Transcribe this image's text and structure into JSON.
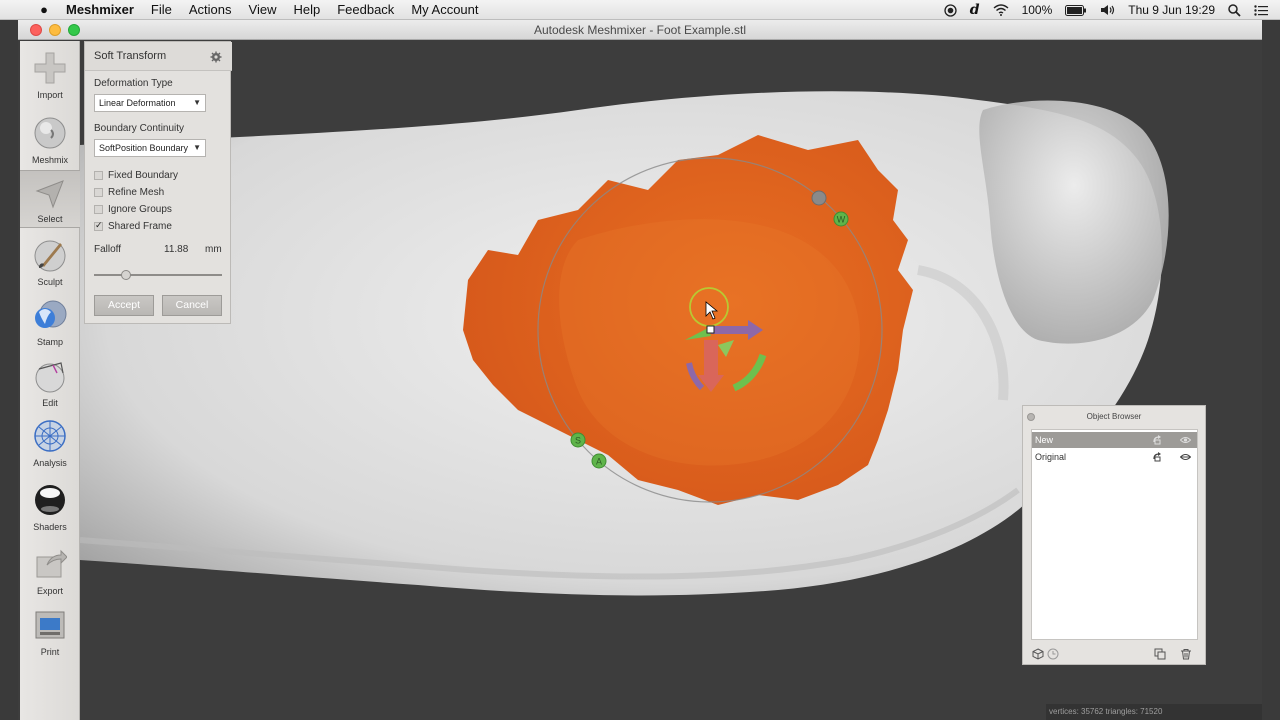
{
  "menubar": {
    "app_name": "Meshmixer",
    "menus": [
      "File",
      "Actions",
      "View",
      "Help",
      "Feedback",
      "My Account"
    ],
    "battery": "100%",
    "clock": "Thu 9 Jun  19:29"
  },
  "window": {
    "title": "Autodesk Meshmixer - Foot Example.stl"
  },
  "toolbar": {
    "items": [
      {
        "label": "Import",
        "icon": "plus-icon"
      },
      {
        "label": "Meshmix",
        "icon": "meshmix-sphere-icon"
      },
      {
        "label": "Select",
        "icon": "select-arrow-icon",
        "active": true
      },
      {
        "label": "Sculpt",
        "icon": "sculpt-brush-icon"
      },
      {
        "label": "Stamp",
        "icon": "stamp-icon"
      },
      {
        "label": "Edit",
        "icon": "edit-sphere-icon"
      },
      {
        "label": "Analysis",
        "icon": "analysis-sphere-icon"
      },
      {
        "label": "Shaders",
        "icon": "shaders-sphere-icon"
      },
      {
        "label": "Export",
        "icon": "export-icon"
      },
      {
        "label": "Print",
        "icon": "printer-icon"
      }
    ]
  },
  "soft_transform": {
    "title": "Soft Transform",
    "deformation_type_label": "Deformation Type",
    "deformation_type_value": "Linear Deformation",
    "boundary_continuity_label": "Boundary Continuity",
    "boundary_continuity_value": "SoftPosition Boundary",
    "checkboxes": [
      {
        "label": "Fixed Boundary",
        "checked": false
      },
      {
        "label": "Refine Mesh",
        "checked": false
      },
      {
        "label": "Ignore Groups",
        "checked": false
      },
      {
        "label": "Shared Frame",
        "checked": true
      }
    ],
    "falloff_label": "Falloff",
    "falloff_value": "11.88",
    "falloff_unit": "mm",
    "falloff_slider_fraction": 0.25,
    "accept_label": "Accept",
    "cancel_label": "Cancel"
  },
  "gizmo": {
    "handle_labels": [
      "W",
      "S",
      "A"
    ]
  },
  "object_browser": {
    "title": "Object Browser",
    "objects": [
      {
        "name": "New",
        "selected": true
      },
      {
        "name": "Original",
        "selected": false
      }
    ]
  },
  "status": {
    "text": "vertices: 35762 triangles: 71520"
  },
  "colors": {
    "selection": "#e0621b",
    "mesh": "#dcdcdc",
    "background": "#3d3d3d"
  }
}
